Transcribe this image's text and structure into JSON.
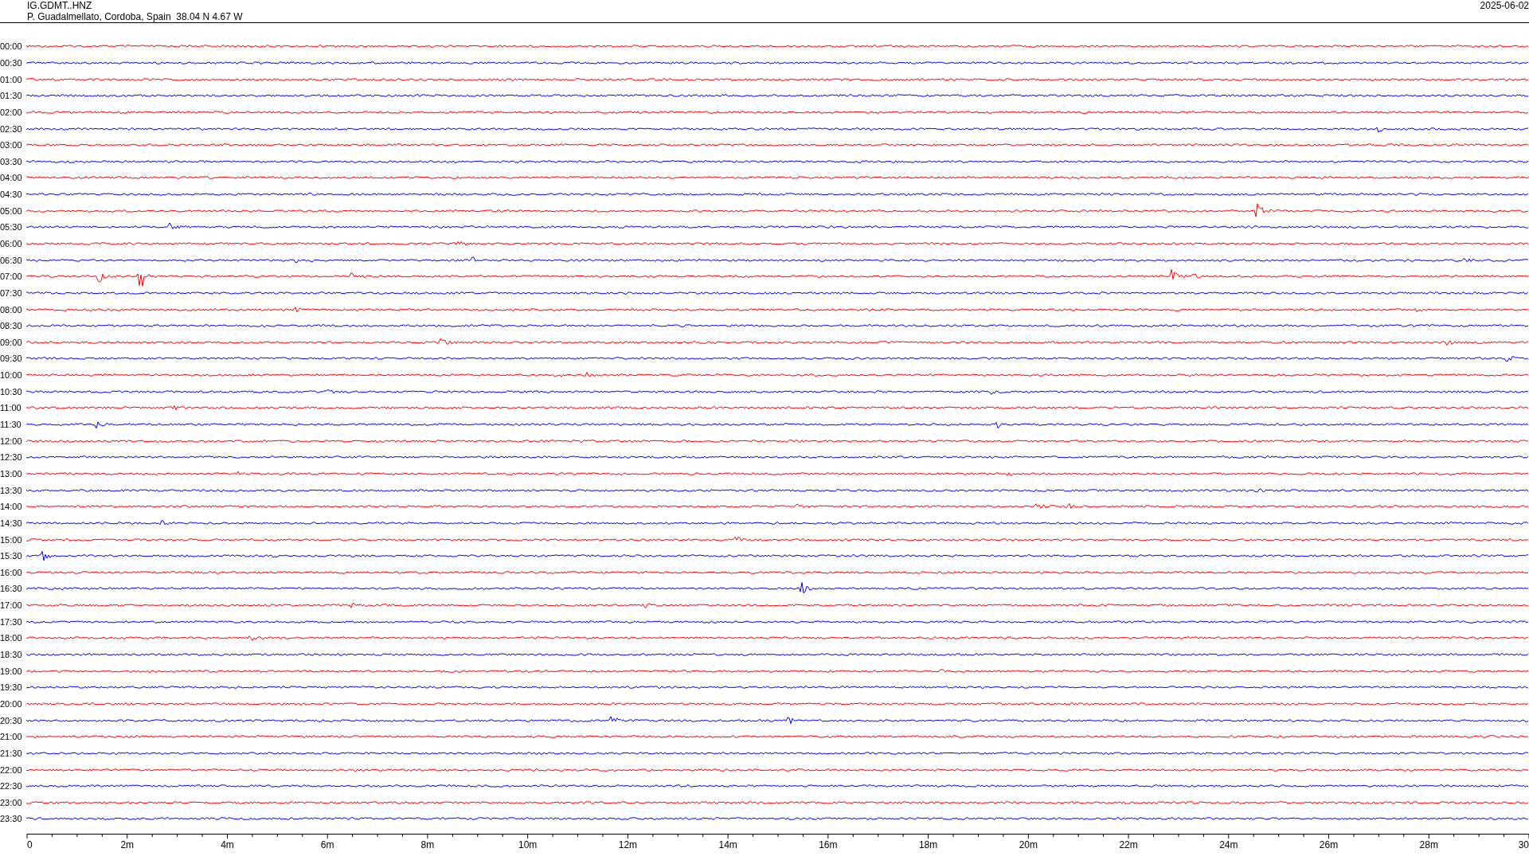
{
  "header": {
    "station": "IG.GDMT..HNZ",
    "location": "P. Guadalmellato, Cordoba, Spain  38.04 N 4.67 W",
    "date": "2025-06-02"
  },
  "traces": [
    {
      "label": "00:00",
      "color": "#ff0000"
    },
    {
      "label": "00:30",
      "color": "#0000ff"
    },
    {
      "label": "01:00",
      "color": "#ff0000"
    },
    {
      "label": "01:30",
      "color": "#0000ff"
    },
    {
      "label": "02:00",
      "color": "#ff0000"
    },
    {
      "label": "02:30",
      "color": "#0000ff"
    },
    {
      "label": "03:00",
      "color": "#ff0000"
    },
    {
      "label": "03:30",
      "color": "#0000ff"
    },
    {
      "label": "04:00",
      "color": "#ff0000"
    },
    {
      "label": "04:30",
      "color": "#0000ff"
    },
    {
      "label": "05:00",
      "color": "#ff0000"
    },
    {
      "label": "05:30",
      "color": "#0000ff"
    },
    {
      "label": "06:00",
      "color": "#ff0000"
    },
    {
      "label": "06:30",
      "color": "#0000ff"
    },
    {
      "label": "07:00",
      "color": "#ff0000"
    },
    {
      "label": "07:30",
      "color": "#0000ff"
    },
    {
      "label": "08:00",
      "color": "#ff0000"
    },
    {
      "label": "08:30",
      "color": "#0000ff"
    },
    {
      "label": "09:00",
      "color": "#ff0000"
    },
    {
      "label": "09:30",
      "color": "#0000ff"
    },
    {
      "label": "10:00",
      "color": "#ff0000"
    },
    {
      "label": "10:30",
      "color": "#0000ff"
    },
    {
      "label": "11:00",
      "color": "#ff0000"
    },
    {
      "label": "11:30",
      "color": "#0000ff"
    },
    {
      "label": "12:00",
      "color": "#ff0000"
    },
    {
      "label": "12:30",
      "color": "#0000ff"
    },
    {
      "label": "13:00",
      "color": "#ff0000"
    },
    {
      "label": "13:30",
      "color": "#0000ff"
    },
    {
      "label": "14:00",
      "color": "#ff0000"
    },
    {
      "label": "14:30",
      "color": "#0000ff"
    },
    {
      "label": "15:00",
      "color": "#ff0000"
    },
    {
      "label": "15:30",
      "color": "#0000ff"
    },
    {
      "label": "16:00",
      "color": "#ff0000"
    },
    {
      "label": "16:30",
      "color": "#0000ff"
    },
    {
      "label": "17:00",
      "color": "#ff0000"
    },
    {
      "label": "17:30",
      "color": "#0000ff"
    },
    {
      "label": "18:00",
      "color": "#ff0000"
    },
    {
      "label": "18:30",
      "color": "#0000ff"
    },
    {
      "label": "19:00",
      "color": "#ff0000"
    },
    {
      "label": "19:30",
      "color": "#0000ff"
    },
    {
      "label": "20:00",
      "color": "#ff0000"
    },
    {
      "label": "20:30",
      "color": "#0000ff"
    },
    {
      "label": "21:00",
      "color": "#ff0000"
    },
    {
      "label": "21:30",
      "color": "#0000ff"
    },
    {
      "label": "22:00",
      "color": "#ff0000"
    },
    {
      "label": "22:30",
      "color": "#0000ff"
    },
    {
      "label": "23:00",
      "color": "#ff0000"
    },
    {
      "label": "23:30",
      "color": "#0000ff"
    }
  ],
  "axis": {
    "ticks": [
      "0",
      "2m",
      "4m",
      "6m",
      "8m",
      "10m",
      "12m",
      "14m",
      "16m",
      "18m",
      "20m",
      "22m",
      "24m",
      "26m",
      "28m",
      "30"
    ]
  }
}
